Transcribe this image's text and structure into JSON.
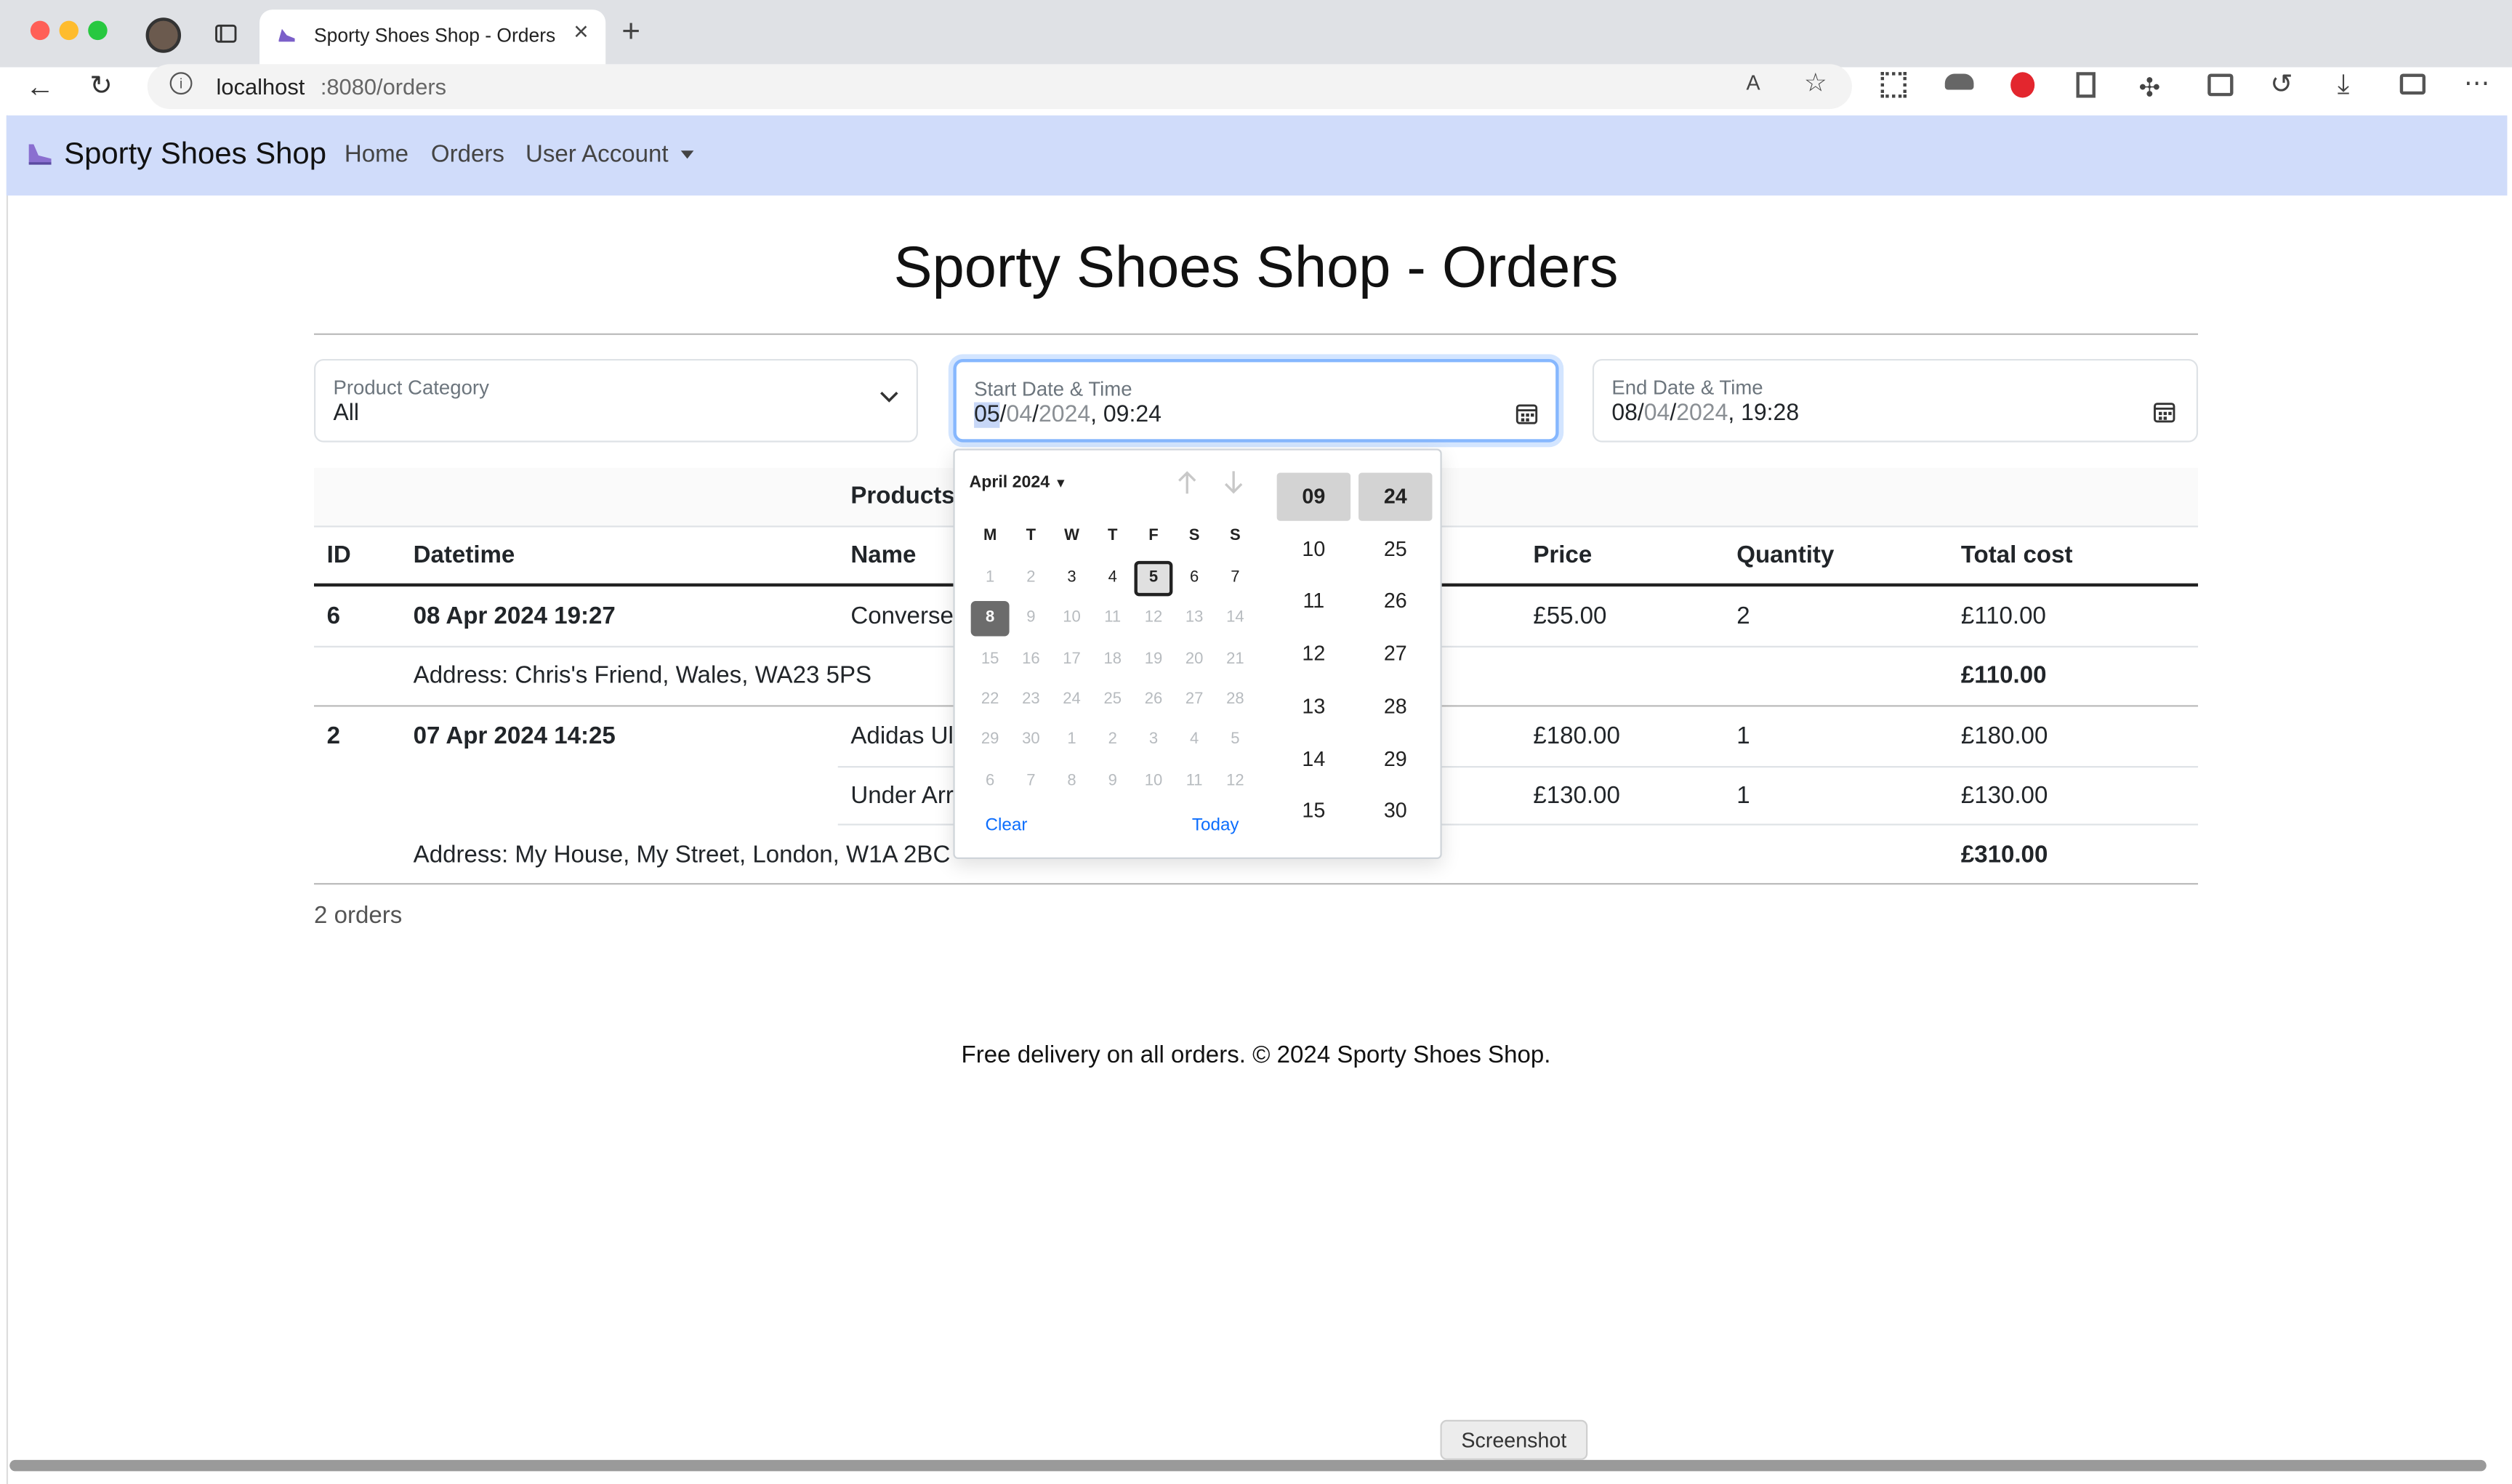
{
  "browser": {
    "tab_title": "Sporty Shoes Shop - Orders",
    "url_host": "localhost",
    "url_path": ":8080/orders",
    "tooltip": "Screenshot"
  },
  "nav": {
    "brand": "Sporty Shoes Shop",
    "links": [
      "Home",
      "Orders",
      "User Account"
    ]
  },
  "page": {
    "title": "Sporty Shoes Shop - Orders",
    "footer": "Free delivery on all orders. © 2024 Sporty Shoes Shop.",
    "order_count": "2 orders"
  },
  "filters": {
    "category": {
      "label": "Product Category",
      "value": "All"
    },
    "start": {
      "label": "Start Date & Time",
      "day": "05",
      "sep1": "/",
      "month": "04",
      "sep2": "/",
      "year": "2024",
      "time": ", 09:24"
    },
    "end": {
      "label": "End Date & Time",
      "day": "08",
      "sep1": "/",
      "month": "04",
      "sep2": "/",
      "year": "2024",
      "time": ", 19:28"
    }
  },
  "table": {
    "group_header": "Products",
    "headers": [
      "ID",
      "Datetime",
      "Name",
      "Price",
      "Quantity",
      "Total cost"
    ],
    "orders": [
      {
        "id": "6",
        "datetime": "08 Apr 2024 19:27",
        "items": [
          {
            "name": "Converse",
            "price": "£55.00",
            "qty": "2",
            "total": "£110.00"
          }
        ],
        "address": "Address: Chris's Friend, Wales, WA23 5PS",
        "sum": "£110.00"
      },
      {
        "id": "2",
        "datetime": "07 Apr 2024 14:25",
        "items": [
          {
            "name": "Adidas Ult",
            "price": "£180.00",
            "qty": "1",
            "total": "£180.00"
          },
          {
            "name": "Under Arr",
            "price": "£130.00",
            "qty": "1",
            "total": "£130.00"
          }
        ],
        "address": "Address: My House, My Street, London, W1A 2BC",
        "sum": "£310.00"
      }
    ]
  },
  "datepicker": {
    "month_label": "April 2024",
    "weekdays": [
      "M",
      "T",
      "W",
      "T",
      "F",
      "S",
      "S"
    ],
    "weeks": [
      [
        "1",
        "2",
        "3",
        "4",
        "5",
        "6",
        "7"
      ],
      [
        "8",
        "9",
        "10",
        "11",
        "12",
        "13",
        "14"
      ],
      [
        "15",
        "16",
        "17",
        "18",
        "19",
        "20",
        "21"
      ],
      [
        "22",
        "23",
        "24",
        "25",
        "26",
        "27",
        "28"
      ],
      [
        "29",
        "30",
        "1",
        "2",
        "3",
        "4",
        "5"
      ],
      [
        "6",
        "7",
        "8",
        "9",
        "10",
        "11",
        "12"
      ]
    ],
    "enabled_days": [
      "3",
      "4",
      "5",
      "6",
      "7",
      "8"
    ],
    "selected_day": "5",
    "today_day": "8",
    "hours": [
      "09",
      "10",
      "11",
      "12",
      "13",
      "14",
      "15"
    ],
    "minutes": [
      "24",
      "25",
      "26",
      "27",
      "28",
      "29",
      "30"
    ],
    "selected_hour": "09",
    "selected_minute": "24",
    "clear_label": "Clear",
    "today_label": "Today"
  },
  "colors": {
    "navbar_bg": "#d0dcfa",
    "link_blue": "#0d6efd",
    "focus_border": "#86b7fe"
  }
}
